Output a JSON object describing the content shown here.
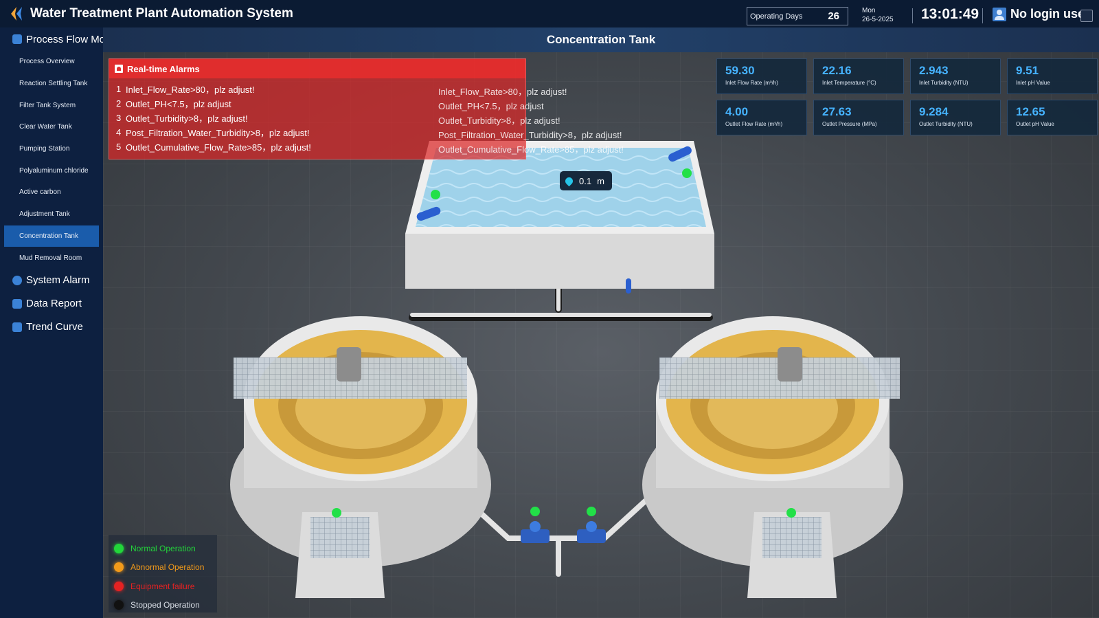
{
  "app": {
    "title": "Water Treatment Plant Automation System",
    "operating_days_label": "Operating Days",
    "operating_days": "26",
    "weekday": "Mon",
    "date": "26-5-2025",
    "time": "13:01:49",
    "user": "No login user"
  },
  "sidebar": {
    "process_flow": "Process Flow Mon",
    "items": [
      "Process Overview",
      "Reaction Settling Tank",
      "Filter Tank System",
      "Clear Water Tank",
      "Pumping Station",
      "Polyaluminum chloride",
      "Active carbon",
      "Adjustment Tank",
      "Concentration Tank",
      "Mud Removal Room"
    ],
    "active_index": 8,
    "system_alarm": "System Alarm",
    "data_report": "Data Report",
    "trend_curve": "Trend Curve"
  },
  "page": {
    "title": "Concentration Tank"
  },
  "alarms": {
    "title": "Real-time Alarms",
    "rows": [
      {
        "num": "1",
        "text": "Inlet_Flow_Rate>80，plz adjust!"
      },
      {
        "num": "2",
        "text": "Outlet_PH<7.5，plz adjust"
      },
      {
        "num": "3",
        "text": "Outlet_Turbidity>8，plz adjust!"
      },
      {
        "num": "4",
        "text": "Post_Filtration_Water_Turbidity>8，plz adjust!"
      },
      {
        "num": "5",
        "text": "Outlet_Cumulative_Flow_Rate>85，plz adjust!"
      }
    ],
    "ghost_rows": [
      "Inlet_Flow_Rate>80，plz adjust!",
      "Outlet_PH<7.5，plz adjust",
      "Outlet_Turbidity>8，plz adjust!",
      "Post_Filtration_Water_Turbidity>8，plz adjust!",
      "Outlet_Cumulative_Flow_Rate>85，plz adjust!"
    ]
  },
  "metrics": {
    "inlet": [
      {
        "value": "59.30",
        "label": "Inlet Flow Rate (m³/h)"
      },
      {
        "value": "22.16",
        "label": "Inlet Temperature (°C)"
      },
      {
        "value": "2.943",
        "label": "Inlet Turbidity (NTU)"
      },
      {
        "value": "9.51",
        "label": "Inlet pH Value"
      }
    ],
    "outlet": [
      {
        "value": "4.00",
        "label": "Outlet Flow Rate (m³/h)"
      },
      {
        "value": "27.63",
        "label": "Outlet Pressure (MPa)"
      },
      {
        "value": "9.284",
        "label": "Outlet Turbidity (NTU)"
      },
      {
        "value": "12.65",
        "label": "Outlet pH Value"
      }
    ]
  },
  "level": {
    "value": "0.1",
    "unit": "m"
  },
  "legend": [
    {
      "label": "Normal Operation",
      "color": "#22d63a"
    },
    {
      "label": "Abnormal Operation",
      "color": "#f29a1a"
    },
    {
      "label": "Equipment failure",
      "color": "#e52222"
    },
    {
      "label": "Stopped Operation",
      "color": "#111111"
    }
  ],
  "colors": {
    "accent_value": "#46b3ff",
    "active_nav": "#1a5cab",
    "alarm_bg": "#dc2828"
  }
}
